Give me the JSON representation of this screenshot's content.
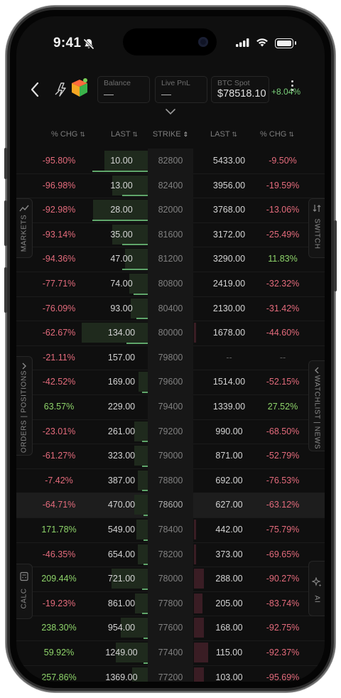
{
  "status": {
    "time": "9:41"
  },
  "header": {
    "balance": {
      "label": "Balance",
      "value": "—"
    },
    "pnl": {
      "label": "Live PnL",
      "value": "—"
    },
    "btc": {
      "label": "BTC Spot",
      "value": "$78518.10",
      "change": "+8.04%"
    }
  },
  "columns": {
    "call_chg": "% CHG",
    "call_last": "LAST",
    "strike": "STRIKE",
    "put_last": "LAST",
    "put_chg": "% CHG"
  },
  "side_tabs": {
    "markets": "MARKETS",
    "orders": "ORDERS | POSITIONS",
    "calc": "CALC",
    "switch": "SWITCH",
    "watchlist": "WATCHLIST | NEWS",
    "ai": "AI"
  },
  "rows": [
    {
      "cchg": "-95.80%",
      "clast": "10.00",
      "strike": "82800",
      "plast": "5433.00",
      "pchg": "-9.50%"
    },
    {
      "cchg": "-96.98%",
      "clast": "13.00",
      "strike": "82400",
      "plast": "3956.00",
      "pchg": "-19.59%"
    },
    {
      "cchg": "-92.98%",
      "clast": "28.00",
      "strike": "82000",
      "plast": "3768.00",
      "pchg": "-13.06%"
    },
    {
      "cchg": "-93.14%",
      "clast": "35.00",
      "strike": "81600",
      "plast": "3172.00",
      "pchg": "-25.49%"
    },
    {
      "cchg": "-94.36%",
      "clast": "47.00",
      "strike": "81200",
      "plast": "3290.00",
      "pchg": "11.83%"
    },
    {
      "cchg": "-77.71%",
      "clast": "74.00",
      "strike": "80800",
      "plast": "2419.00",
      "pchg": "-32.32%"
    },
    {
      "cchg": "-76.09%",
      "clast": "93.00",
      "strike": "80400",
      "plast": "2130.00",
      "pchg": "-31.42%"
    },
    {
      "cchg": "-62.67%",
      "clast": "134.00",
      "strike": "80000",
      "plast": "1678.00",
      "pchg": "-44.60%"
    },
    {
      "cchg": "-21.11%",
      "clast": "157.00",
      "strike": "79800",
      "plast": "--",
      "pchg": "--"
    },
    {
      "cchg": "-42.52%",
      "clast": "169.00",
      "strike": "79600",
      "plast": "1514.00",
      "pchg": "-52.15%"
    },
    {
      "cchg": "63.57%",
      "clast": "229.00",
      "strike": "79400",
      "plast": "1339.00",
      "pchg": "27.52%"
    },
    {
      "cchg": "-23.01%",
      "clast": "261.00",
      "strike": "79200",
      "plast": "990.00",
      "pchg": "-68.50%"
    },
    {
      "cchg": "-61.27%",
      "clast": "323.00",
      "strike": "79000",
      "plast": "871.00",
      "pchg": "-52.79%"
    },
    {
      "cchg": "-7.42%",
      "clast": "387.00",
      "strike": "78800",
      "plast": "692.00",
      "pchg": "-76.53%"
    },
    {
      "cchg": "-64.71%",
      "clast": "470.00",
      "strike": "78600",
      "plast": "627.00",
      "pchg": "-63.12%"
    },
    {
      "cchg": "171.78%",
      "clast": "549.00",
      "strike": "78400",
      "plast": "442.00",
      "pchg": "-75.79%"
    },
    {
      "cchg": "-46.35%",
      "clast": "654.00",
      "strike": "78200",
      "plast": "373.00",
      "pchg": "-69.65%"
    },
    {
      "cchg": "209.44%",
      "clast": "721.00",
      "strike": "78000",
      "plast": "288.00",
      "pchg": "-90.27%"
    },
    {
      "cchg": "-19.23%",
      "clast": "861.00",
      "strike": "77800",
      "plast": "205.00",
      "pchg": "-83.74%"
    },
    {
      "cchg": "238.30%",
      "clast": "954.00",
      "strike": "77600",
      "plast": "168.00",
      "pchg": "-92.75%"
    },
    {
      "cchg": "59.92%",
      "clast": "1249.00",
      "strike": "77400",
      "plast": "115.00",
      "pchg": "-92.37%"
    },
    {
      "cchg": "257.86%",
      "clast": "1369.00",
      "strike": "77200",
      "plast": "103.00",
      "pchg": "-95.69%"
    }
  ],
  "call_volume_fraction": [
    0.95,
    0.78,
    1.2,
    0.78,
    0.5,
    0.4,
    0.38,
    1.45,
    0.0,
    0.2,
    0.0,
    0.3,
    0.3,
    0.22,
    0.3,
    0.25,
    0.22,
    0.8,
    0.28,
    0.6,
    0.7,
    0.35
  ],
  "call_oi_fraction": [
    0.98,
    0.45,
    0.98,
    0.45,
    0.45,
    0.25,
    0.2,
    0.38,
    0.0,
    0.1,
    0.0,
    0.1,
    0.1,
    0.1,
    0.08,
    0.08,
    0.08,
    0.1,
    0.1,
    0.08,
    0.08,
    0.08
  ],
  "put_volume_fraction": [
    0,
    0,
    0,
    0,
    0,
    0,
    0,
    0.04,
    0,
    0,
    0,
    0,
    0,
    0,
    0,
    0.04,
    0.04,
    0.18,
    0.15,
    0.18,
    0.25,
    0.18
  ],
  "highlight_row": 14,
  "colors": {
    "negative": "#e46b7c",
    "positive": "#8ed46a",
    "accent": "#5fa56a"
  }
}
